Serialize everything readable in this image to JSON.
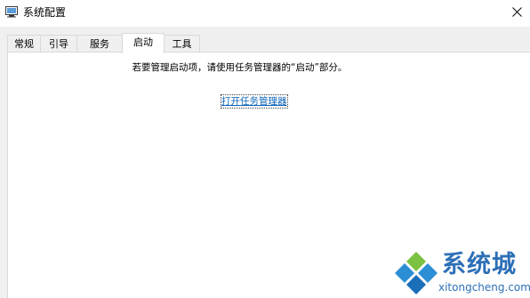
{
  "window": {
    "title": "系统配置",
    "icon": "msconfig-icon",
    "close_icon": "close-icon"
  },
  "tabs": [
    {
      "label": "常规",
      "active": false
    },
    {
      "label": "引导",
      "active": false
    },
    {
      "label": "服务",
      "active": false
    },
    {
      "label": "启动",
      "active": true
    },
    {
      "label": "工具",
      "active": false
    }
  ],
  "startup_panel": {
    "message": "若要管理启动项，请使用任务管理器的“启动”部分。",
    "link_label": "打开任务管理器"
  },
  "watermark": {
    "brand": "系统城",
    "domain": "xitongcheng.com"
  },
  "colors": {
    "link": "#0e64b8",
    "tab_border": "#d9d9d9",
    "dialog_bg": "#f0f0f0",
    "brand_blue": "#2c6fb7",
    "brand_green": "#7cc242"
  }
}
